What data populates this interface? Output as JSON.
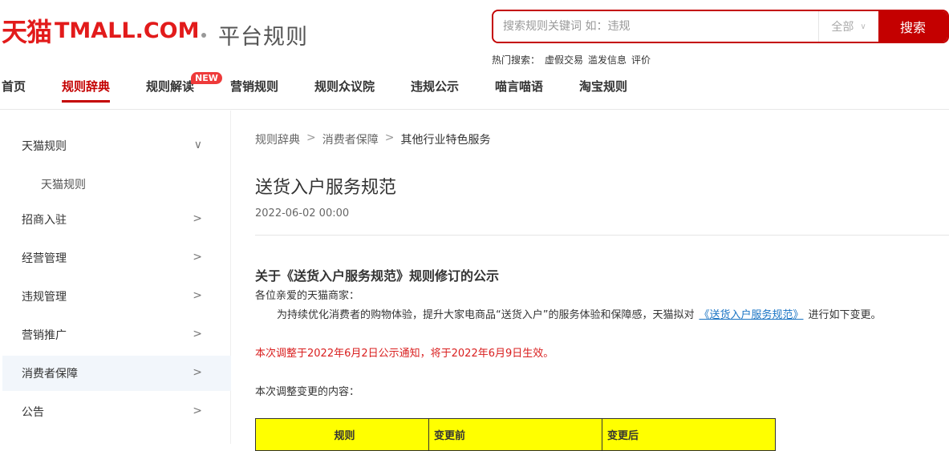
{
  "logo": {
    "cn": "天猫",
    "en": "TMALL.COM",
    "sub": "平台规则",
    "color": "#e21b1b"
  },
  "search": {
    "placeholder": "搜索规则关键词 如：违规",
    "scope": "全部",
    "button": "搜索"
  },
  "hot": {
    "label": "热门搜索：",
    "terms": [
      "虚假交易",
      "滥发信息",
      "评价"
    ]
  },
  "nav": {
    "items": [
      "首页",
      "规则辞典",
      "规则解读",
      "营销规则",
      "规则众议院",
      "违规公示",
      "喵言喵语",
      "淘宝规则"
    ],
    "active": "规则辞典",
    "badge": "NEW"
  },
  "sidebar": {
    "items": [
      "天猫规则",
      "招商入驻",
      "经营管理",
      "违规管理",
      "营销推广",
      "消费者保障",
      "公告"
    ],
    "sub": "天猫规则",
    "active": "消费者保障"
  },
  "breadcrumb": [
    "规则辞典",
    "消费者保障",
    "其他行业特色服务"
  ],
  "article": {
    "title": "送货入户服务规范",
    "date": "2022-06-02 00:00",
    "section_title": "关于《送货入户服务规范》规则修订的公示",
    "greeting": "各位亲爱的天猫商家：",
    "para_before": "为持续优化消费者的购物体验，提升大家电商品“送货入户”的服务体验和保障感，天猫拟对",
    "para_link": "《送货入户服务规范》",
    "para_after": "进行如下变更。",
    "notice": "本次调整于2022年6月2日公示通知，将于2022年6月9日生效。",
    "content_label": "本次调整变更的内容：",
    "table_headers": [
      "规则",
      "变更前",
      "变更后"
    ]
  }
}
